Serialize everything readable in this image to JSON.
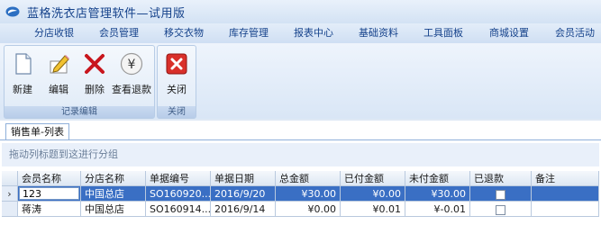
{
  "window": {
    "title": "蓝格洗衣店管理软件—试用版",
    "logo_icon": "app-logo-icon"
  },
  "menu": [
    {
      "label": "分店收银"
    },
    {
      "label": "会员管理"
    },
    {
      "label": "移交衣物"
    },
    {
      "label": "库存管理"
    },
    {
      "label": "报表中心"
    },
    {
      "label": "基础资料"
    },
    {
      "label": "工具面板"
    },
    {
      "label": "商城设置"
    },
    {
      "label": "会员活动"
    }
  ],
  "ribbon": {
    "groups": [
      {
        "caption": "记录编辑",
        "buttons": [
          {
            "label": "新建",
            "icon": "new-document-icon"
          },
          {
            "label": "编辑",
            "icon": "edit-pencil-icon"
          },
          {
            "label": "删除",
            "icon": "delete-x-icon"
          },
          {
            "label": "查看退款",
            "icon": "yen-refund-icon"
          }
        ]
      },
      {
        "caption": "关闭",
        "buttons": [
          {
            "label": "关闭",
            "icon": "close-red-icon"
          }
        ]
      }
    ]
  },
  "content": {
    "tab_label": "销售单-列表",
    "group_hint": "拖动列标题到这进行分组",
    "columns": [
      "会员名称",
      "分店名称",
      "单据编号",
      "单据日期",
      "总金额",
      "已付金额",
      "未付金额",
      "已退款",
      "备注"
    ],
    "rows": [
      {
        "selected": true,
        "member": "123",
        "store": "中国总店",
        "doc_no": "SO160920...",
        "date": "2016/9/20",
        "total": "¥30.00",
        "paid": "¥0.00",
        "unpaid": "¥30.00",
        "refunded": false,
        "note": ""
      },
      {
        "selected": false,
        "member": "蒋涛",
        "store": "中国总店",
        "doc_no": "SO160914...",
        "date": "2016/9/14",
        "total": "¥0.00",
        "paid": "¥0.01",
        "unpaid": "¥-0.01",
        "refunded": false,
        "note": ""
      }
    ],
    "row_indicator": "›"
  },
  "colors": {
    "accent": "#15428b",
    "selection": "#3a6fc4",
    "delete_red": "#c8161d",
    "close_red": "#d9302a"
  }
}
